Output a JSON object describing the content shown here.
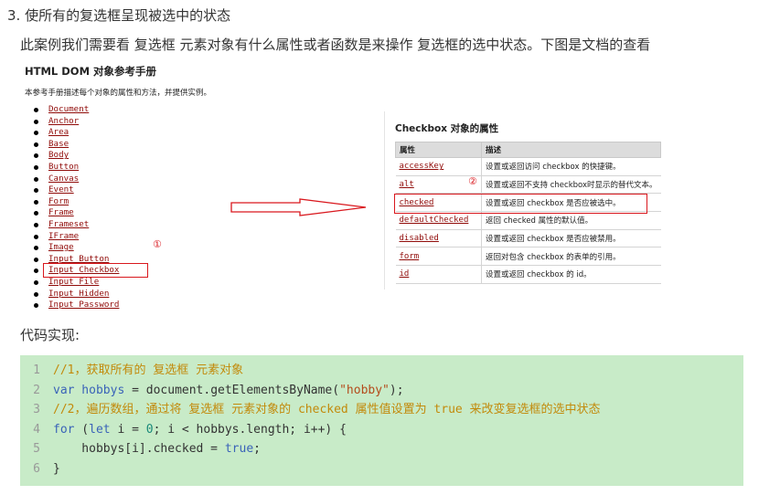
{
  "heading": "3. 使所有的复选框呈现被选中的状态",
  "intro": "此案例我们需要看 复选框 元素对象有什么属性或者函数是来操作 复选框的选中状态。下图是文档的查看",
  "doc": {
    "title": "HTML DOM 对象参考手册",
    "desc": "本参考手册描述每个对象的属性和方法，并提供实例。",
    "items": [
      "Document",
      "Anchor",
      "Area",
      "Base",
      "Body",
      "Button",
      "Canvas",
      "Event",
      "Form",
      "Frame",
      "Frameset",
      "IFrame",
      "Image",
      "Input Button",
      "Input Checkbox",
      "Input File",
      "Input Hidden",
      "Input Password"
    ],
    "marker": "①"
  },
  "props": {
    "title": "Checkbox 对象的属性",
    "headers": [
      "属性",
      "描述"
    ],
    "marker": "②",
    "rows": [
      {
        "name": "accessKey",
        "desc": "设置或返回访问 checkbox 的快捷键。"
      },
      {
        "name": "alt",
        "desc": "设置或返回不支持 checkbox时显示的替代文本。"
      },
      {
        "name": "checked",
        "desc": "设置或返回 checkbox 是否应被选中。"
      },
      {
        "name": "defaultChecked",
        "desc": "返回 checked 属性的默认值。"
      },
      {
        "name": "disabled",
        "desc": "设置或返回 checkbox 是否应被禁用。"
      },
      {
        "name": "form",
        "desc": "返回对包含 checkbox 的表单的引用。"
      },
      {
        "name": "id",
        "desc": "设置或返回 checkbox 的 id。"
      }
    ]
  },
  "impl_label": "代码实现:",
  "code": {
    "line_numbers": [
      "1",
      "2",
      "3",
      "4",
      "5",
      "6"
    ],
    "l1_comment": "//1，获取所有的 复选框 元素对象",
    "l2_var": "var",
    "l2_name": " hobbys ",
    "l2_rest": "= document.getElementsByName(",
    "l2_str": "\"hobby\"",
    "l2_end": ");",
    "l3_c1": "//2，遍历数组，通过将 复选框 元素对象的 ",
    "l3_checked": "checked",
    "l3_c2": " 属性值设置为 ",
    "l3_true": "true",
    "l3_c3": " 来改变复选框的选中状态",
    "l4_for": "for",
    "l4_a": " (",
    "l4_let": "let",
    "l4_b": " i = ",
    "l4_zero": "0",
    "l4_c": "; i < hobbys.length; i++) {",
    "l5_a": "    hobbys[i].checked = ",
    "l5_true": "true",
    "l5_b": ";",
    "l6": "}"
  },
  "colors": {
    "highlight": "#d9171d",
    "code_bg": "#c8ebc8",
    "link": "#900b09"
  }
}
